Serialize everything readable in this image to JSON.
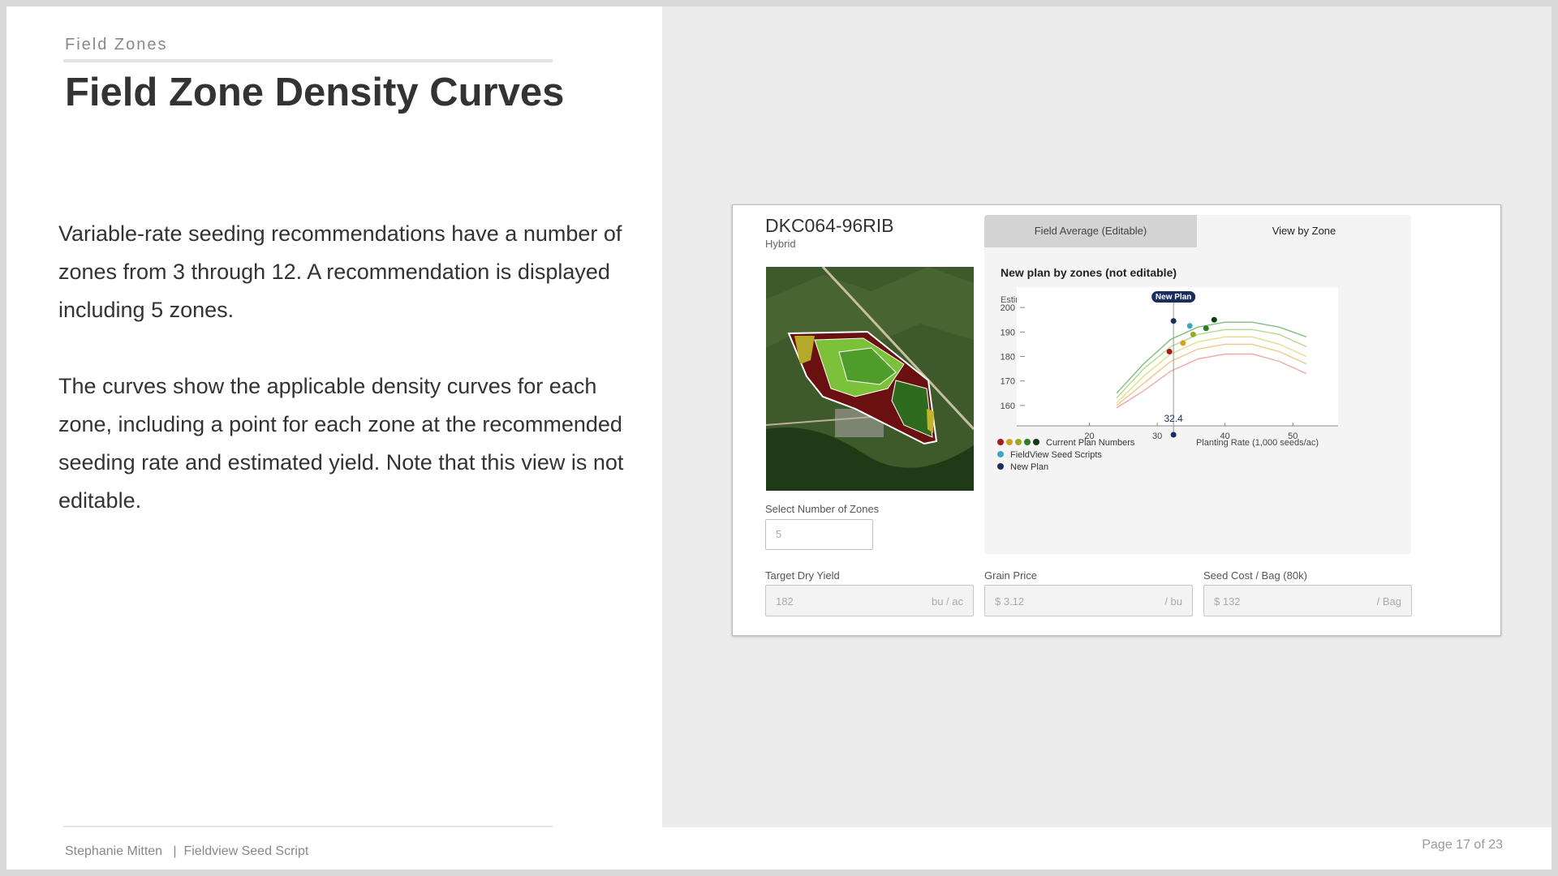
{
  "slide": {
    "section": "Field Zones",
    "title": "Field Zone Density Curves",
    "paragraphs": [
      "Variable-rate seeding recommendations have a number of zones from 3 through 12.  A recommendation is displayed including 5 zones.",
      "The curves show the applicable density curves for each zone, including a point for each zone at the recommended seeding rate and estimated yield.   Note that this view is not editable."
    ],
    "footer_left": "Stephanie Mitten   |  Fieldview Seed Script",
    "footer_right": "Page 17 of 23"
  },
  "app": {
    "hybrid_name": "DKC064-96RIB",
    "hybrid_type": "Hybrid",
    "select_zones_label": "Select Number of Zones",
    "select_zones_value": "5",
    "tabs": [
      {
        "label": "Field Average (Editable)",
        "active": false
      },
      {
        "label": "View by Zone",
        "active": true
      }
    ],
    "chart_heading": "New plan by zones (not editable)",
    "fields": [
      {
        "label": "Target Dry Yield",
        "value": "182",
        "unit": "bu / ac"
      },
      {
        "label": "Grain Price",
        "value": "$ 3.12",
        "unit": "/ bu"
      },
      {
        "label": "Seed Cost / Bag (80k)",
        "value": "$ 132",
        "unit": "/ Bag"
      }
    ]
  },
  "chart_data": {
    "type": "line",
    "ylabel": "Estimated Yield (bu/ac)",
    "xlabel": "Planting Rate (1,000 seeds/ac)",
    "xlim": [
      10,
      55
    ],
    "ylim": [
      155,
      205
    ],
    "x_ticks": [
      20,
      30,
      40,
      50
    ],
    "y_ticks": [
      160,
      170,
      180,
      190,
      200
    ],
    "new_plan_label": "New Plan",
    "new_plan_rate": 32.4,
    "new_plan_rate_label": "32.4",
    "series": [
      {
        "color": "#7fbf7f",
        "x": [
          24,
          28,
          32,
          36,
          40,
          44,
          48,
          52
        ],
        "y": [
          165,
          177,
          187,
          192,
          194,
          194,
          192,
          188
        ]
      },
      {
        "color": "#b3d98c",
        "x": [
          24,
          28,
          32,
          36,
          40,
          44,
          48,
          52
        ],
        "y": [
          163,
          175,
          184,
          189,
          191,
          191,
          189,
          184
        ]
      },
      {
        "color": "#e0e08a",
        "x": [
          24,
          28,
          32,
          36,
          40,
          44,
          48,
          52
        ],
        "y": [
          161,
          172,
          181,
          186,
          188,
          188,
          185,
          180
        ]
      },
      {
        "color": "#f1c68a",
        "x": [
          24,
          28,
          32,
          36,
          40,
          44,
          48,
          52
        ],
        "y": [
          160,
          169,
          178,
          183,
          185,
          185,
          182,
          177
        ]
      },
      {
        "color": "#f0a8a8",
        "x": [
          24,
          28,
          32,
          36,
          40,
          44,
          48,
          52
        ],
        "y": [
          159,
          166,
          174,
          179,
          181,
          181,
          178,
          173
        ]
      }
    ],
    "points": [
      {
        "group": "new_plan",
        "x": 32.4,
        "y": 194.5,
        "color": "#1a2e5c"
      },
      {
        "group": "fieldview",
        "x": 34.8,
        "y": 192.5,
        "color": "#3ba8c4"
      },
      {
        "group": "current",
        "x": 38.4,
        "y": 195.0,
        "color": "#0f3d0f"
      },
      {
        "group": "current",
        "x": 37.2,
        "y": 191.5,
        "color": "#2e7d1e"
      },
      {
        "group": "current",
        "x": 35.3,
        "y": 189.0,
        "color": "#9aaa22"
      },
      {
        "group": "current",
        "x": 33.8,
        "y": 185.5,
        "color": "#d1a21c"
      },
      {
        "group": "current",
        "x": 31.8,
        "y": 182.0,
        "color": "#a61c1c"
      }
    ],
    "legend": [
      {
        "label": "Current Plan Numbers",
        "colors": [
          "#a61c1c",
          "#d1a21c",
          "#9aaa22",
          "#2e7d1e",
          "#0f3d0f"
        ]
      },
      {
        "label": "FieldView Seed Scripts",
        "colors": [
          "#3ba8c4"
        ]
      },
      {
        "label": "New Plan",
        "colors": [
          "#1a2e5c"
        ]
      }
    ]
  }
}
